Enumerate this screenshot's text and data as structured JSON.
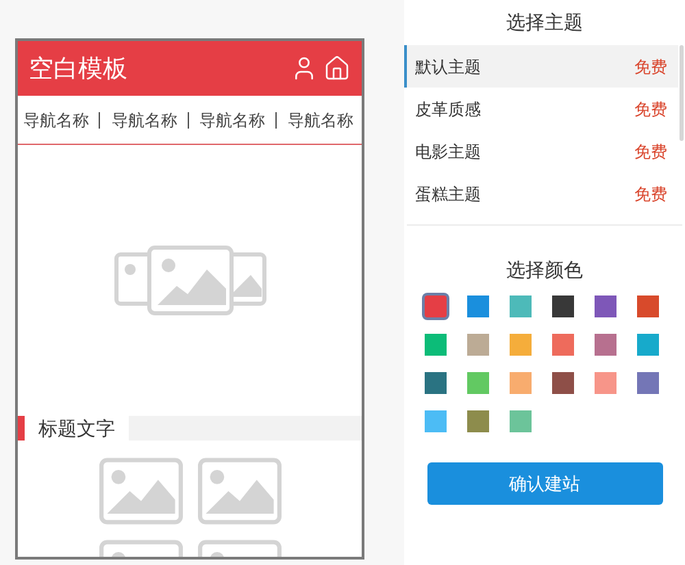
{
  "preview": {
    "title": "空白模板",
    "nav": [
      "导航名称",
      "导航名称",
      "导航名称",
      "导航名称"
    ],
    "section_title": "标题文字"
  },
  "theme_section": {
    "title": "选择主题",
    "themes": [
      {
        "name": "默认主题",
        "price": "免费",
        "selected": true
      },
      {
        "name": "皮革质感",
        "price": "免费",
        "selected": false
      },
      {
        "name": "电影主题",
        "price": "免费",
        "selected": false
      },
      {
        "name": "蛋糕主题",
        "price": "免费",
        "selected": false
      }
    ]
  },
  "color_section": {
    "title": "选择颜色",
    "colors": [
      {
        "color": "#e53e45",
        "selected": true
      },
      {
        "color": "#1a8fdd",
        "selected": false
      },
      {
        "color": "#4dbab9",
        "selected": false
      },
      {
        "color": "#383838",
        "selected": false
      },
      {
        "color": "#7e57b8",
        "selected": false
      },
      {
        "color": "#d84a2b",
        "selected": false
      },
      {
        "color": "#0cbc78",
        "selected": false
      },
      {
        "color": "#bcab95",
        "selected": false
      },
      {
        "color": "#f5ad3b",
        "selected": false
      },
      {
        "color": "#ee6b5c",
        "selected": false
      },
      {
        "color": "#b7708f",
        "selected": false
      },
      {
        "color": "#17aacb",
        "selected": false
      },
      {
        "color": "#2a7382",
        "selected": false
      },
      {
        "color": "#62c962",
        "selected": false
      },
      {
        "color": "#f8ac6e",
        "selected": false
      },
      {
        "color": "#8e4f48",
        "selected": false
      },
      {
        "color": "#f79589",
        "selected": false
      },
      {
        "color": "#7476b6",
        "selected": false
      },
      {
        "color": "#4cbcf5",
        "selected": false
      },
      {
        "color": "#8d8c4c",
        "selected": false
      },
      {
        "color": "#6cc49a",
        "selected": false
      }
    ]
  },
  "confirm_button": "确认建站"
}
